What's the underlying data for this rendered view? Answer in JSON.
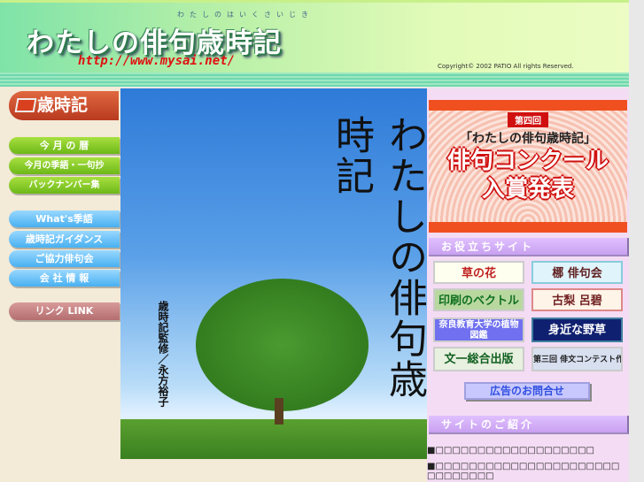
{
  "header": {
    "title": "わたしの俳句歳時記",
    "ruby": "わたしのはいくさいじき",
    "url": "http://www.mysai.net/",
    "copyright": "Copyright© 2002 PATIO All rights Reserved."
  },
  "leftnav": {
    "section_title": "歳時記",
    "green": [
      "今 月 の 暦",
      "今月の季語・一句抄",
      "バックナンバー集"
    ],
    "blue": [
      "What's季語",
      "歳時記ガイダンス",
      "ご協力俳句会",
      "会 社 情 報"
    ],
    "link": "リンク LINK"
  },
  "cover": {
    "title": "わたしの俳句歳時記",
    "subtitle": "歳時記監修／永方裕子"
  },
  "right": {
    "contest": {
      "edition": "第四回",
      "name": "「わたしの俳句歳時記」",
      "line1": "俳句コンクール",
      "line2": "入賞発表"
    },
    "useful_title": "お役立ちサイト",
    "banners": [
      "草の花",
      "梛 俳句会",
      "印刷のベクトル",
      "古梨 呂碧",
      "奈良教育大学の植物図鑑",
      "身近な野草",
      "文一総合出版",
      "第三回 俳文コンテスト作品募集"
    ],
    "ad_button": "広告のお問合せ",
    "intro_title": "サイトのご紹介",
    "lines": [
      "■□□□□□□□□□□□□□□□□□□□",
      "■□□□□□□□□□□□□□□□□□□□□□□□□□□□□□□"
    ]
  },
  "colors": {
    "accent_green": "#6cb818",
    "accent_blue": "#48b0f0",
    "banner_red": "#f05020"
  }
}
